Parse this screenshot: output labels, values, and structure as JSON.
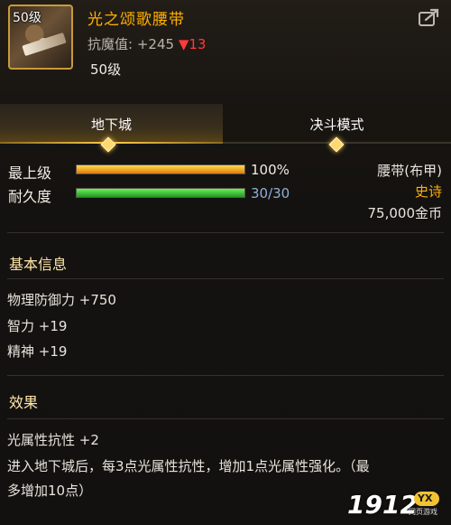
{
  "item": {
    "level_badge": "50级",
    "name": "光之颂歌腰带",
    "resist_label": "抗魔值:",
    "resist_value": "+245",
    "resist_delta": "▼13",
    "level_text": "50级"
  },
  "tabs": [
    {
      "label": "地下城",
      "active": true
    },
    {
      "label": "决斗模式",
      "active": false
    }
  ],
  "stats": {
    "top_level_label": "最上级",
    "top_level_percent": "100%",
    "top_level_fraction": 1.0,
    "durability_label": "耐久度",
    "durability_value": "30/30",
    "durability_fraction": 1.0
  },
  "meta": {
    "type": "腰带(布甲)",
    "rarity": "史诗",
    "price": "75,000金币"
  },
  "basic_info": {
    "title": "基本信息",
    "lines": [
      "物理防御力 +750",
      "智力 +19",
      "精神 +19"
    ]
  },
  "effects": {
    "title": "效果",
    "lines": [
      "光属性抗性 +2",
      "进入地下城后，每3点光属性抗性，增加1点光属性强化。（最",
      "多增加10点）"
    ]
  },
  "watermark": {
    "number": "1912",
    "badge": "YX",
    "caption": "网页游戏"
  },
  "colors": {
    "title": "#ffb000",
    "delta_down": "#ff3a3a",
    "epic": "#ffb000",
    "bar_top": "#f0a020",
    "bar_durability": "#3cc83a"
  },
  "icons": {
    "share": "share-icon"
  }
}
